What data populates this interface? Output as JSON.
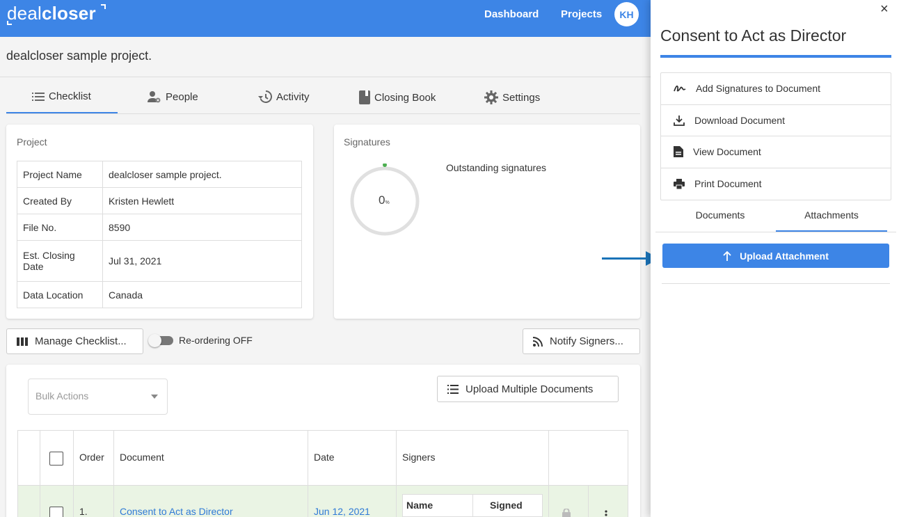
{
  "app": {
    "logo_prefix": "deal",
    "logo_bold": "closer",
    "nav": {
      "dashboard": "Dashboard",
      "projects": "Projects"
    },
    "avatar_initials": "KH",
    "accent_color": "#3d85e6"
  },
  "project": {
    "title": "dealcloser sample project.",
    "tabs": [
      {
        "label": "Checklist",
        "icon": "list-icon",
        "active": true
      },
      {
        "label": "People",
        "icon": "people-gear-icon"
      },
      {
        "label": "Activity",
        "icon": "history-icon"
      },
      {
        "label": "Closing Book",
        "icon": "book-icon"
      },
      {
        "label": "Settings",
        "icon": "gear-icon"
      }
    ],
    "card_label": "Project",
    "rows": [
      {
        "label": "Project Name",
        "value": "dealcloser sample project."
      },
      {
        "label": "Created By",
        "value": "Kristen Hewlett"
      },
      {
        "label": "File No.",
        "value": "8590"
      },
      {
        "label": "Est. Closing Date",
        "value": "Jul 31, 2021"
      },
      {
        "label": "Data Location",
        "value": "Canada"
      }
    ]
  },
  "signatures": {
    "card_label": "Signatures",
    "count": "0",
    "unit": "%",
    "outstanding_label": "Outstanding signatures"
  },
  "toolbar": {
    "manage_checklist": "Manage Checklist...",
    "reordering": "Re-ordering OFF",
    "notify_signers": "Notify Signers..."
  },
  "checklist": {
    "bulk_actions_placeholder": "Bulk Actions",
    "upload_multiple": "Upload Multiple Documents",
    "headers": {
      "order": "Order",
      "document": "Document",
      "date": "Date",
      "signers": "Signers"
    },
    "rows": [
      {
        "order": "1.",
        "document": "Consent to Act as Director",
        "date": "Jun 12, 2021",
        "signers_headers": {
          "name": "Name",
          "signed": "Signed"
        }
      }
    ]
  },
  "panel": {
    "title": "Consent to Act as Director",
    "close_glyph": "×",
    "menu": [
      {
        "label": "Add Signatures to Document",
        "icon": "signature-icon"
      },
      {
        "label": "Download Document",
        "icon": "download-icon"
      },
      {
        "label": "View Document",
        "icon": "document-icon"
      },
      {
        "label": "Print Document",
        "icon": "print-icon"
      }
    ],
    "tabs": {
      "documents": "Documents",
      "attachments": "Attachments",
      "active": "attachments"
    },
    "upload_attachment": "Upload Attachment"
  }
}
